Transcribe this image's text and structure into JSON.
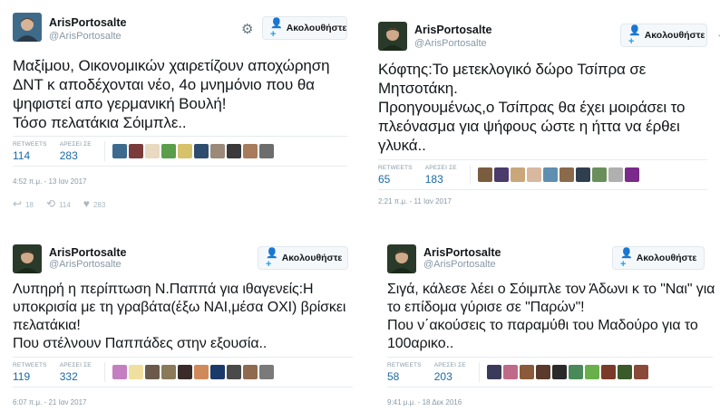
{
  "follow_label": "Ακολουθήστε",
  "retweets_label": "RETWEETS",
  "likes_label": "ΑΡΕΣΕΙ ΣΕ",
  "tweets": [
    {
      "name": "ArisPortosalte",
      "handle": "@ArisPortosalte",
      "text": "Μαξίμου, Οικονομικών χαιρετίζουν αποχώρηση ΔΝΤ κ αποδέχονται νέο, 4ο μνημόνιο που θα ψηφιστεί απο γερμανική Βουλή!\nΤόσο πελατάκια Σόιμπλε..",
      "retweets": "114",
      "likes": "283",
      "time": "4:52 π.μ. - 13 Ιαν 2017",
      "reply_count": "18",
      "retweet_count": "114",
      "like_count": "283",
      "face_colors": [
        "#3d6b8f",
        "#7a3b3b",
        "#e8d9c0",
        "#5a9e4b",
        "#d6c26a",
        "#2e4d6e",
        "#9b8a7a",
        "#3a3a3a",
        "#a77b5c",
        "#6d6d6d"
      ]
    },
    {
      "name": "ArisPortosalte",
      "handle": "@ArisPortosalte",
      "text": "Κόφτης:Το μετεκλογικό δώρο Τσίπρα σε Μητσοτάκη.\nΠροηγουμένως,ο Τσίπρας θα έχει μοιράσει το πλεόνασμα για ψήφους ώστε η ήττα να έρθει γλυκά..",
      "retweets": "65",
      "likes": "183",
      "time": "2:21 π.μ. - 11 Ιαν 2017",
      "face_colors": [
        "#7a5c3e",
        "#4a3b6b",
        "#c9a77a",
        "#d9b8a0",
        "#5f8fb0",
        "#8a6a4a",
        "#2f3f4f",
        "#6b8f5a",
        "#b0b0b0",
        "#7a2a8a"
      ]
    },
    {
      "name": "ArisPortosalte",
      "handle": "@ArisPortosalte",
      "text": "Λυπηρή η περίπτωση Ν.Παππά για ιθαγενείς:Η υποκρισία με τη γραβάτα(έξω ΝΑΙ,μέσα ΟΧΙ) βρίσκει πελατάκια!\nΠου στέλνουν Παππάδες στην εξουσία..",
      "retweets": "119",
      "likes": "332",
      "time": "6:07 π.μ. - 21 Ιαν 2017",
      "face_colors": [
        "#c47fc0",
        "#f0e0a0",
        "#6b5a4a",
        "#8a7a5a",
        "#3a2a2a",
        "#d08a5a",
        "#1a3a6a",
        "#4a4a4a",
        "#8f6a4f",
        "#7a7a7a"
      ]
    },
    {
      "name": "ArisPortosalte",
      "handle": "@ArisPortosalte",
      "text": "Σιγά, κάλεσε λέει ο Σόιμπλε τον Άδωνι κ το \"Ναι\" για το επίδομα γύρισε σε \"Παρών\"!\nΠου ν΄ακούσεις το παραμύθι του Μαδούρο για το 100αρικο..",
      "retweets": "58",
      "likes": "203",
      "time": "9:41 μ.μ. - 18 Δεκ 2016",
      "face_colors": [
        "#3a3a5a",
        "#c06a8a",
        "#8a5a3a",
        "#5a3a2a",
        "#2a2a2a",
        "#4a8a5a",
        "#6ab04a",
        "#7a3a2a",
        "#3a5a2a",
        "#8a4a3a"
      ]
    }
  ]
}
